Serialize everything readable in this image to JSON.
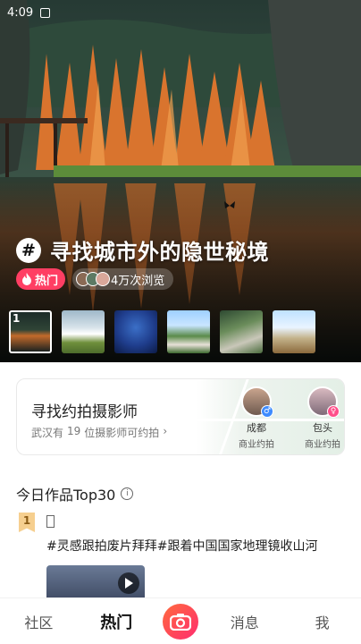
{
  "status_bar": {
    "time": "4:09"
  },
  "hero": {
    "title": "寻找城市外的隐世秘境",
    "hot_label": "热门",
    "views_label": "4万次浏览",
    "thumbnails": [
      {
        "index_label": "1",
        "active": true
      },
      {
        "index_label": "",
        "active": false
      },
      {
        "index_label": "",
        "active": false
      },
      {
        "index_label": "",
        "active": false
      },
      {
        "index_label": "",
        "active": false
      },
      {
        "index_label": "",
        "active": false
      }
    ]
  },
  "photographer_card": {
    "title": "寻找约拍摄影师",
    "subtitle_prefix": "武汉有",
    "subtitle_count": "19",
    "subtitle_suffix": "位摄影师可约拍",
    "people": [
      {
        "city": "成都",
        "tag": "商业约拍",
        "gender": "male",
        "gender_color": "#3d8bff"
      },
      {
        "city": "包头",
        "tag": "商业约拍",
        "gender": "female",
        "gender_color": "#ff4f8a"
      }
    ]
  },
  "top30": {
    "title": "今日作品Top30",
    "items": [
      {
        "rank": "1",
        "tags": "#灵感跟拍废片拜拜#跟着中国国家地理镜收山河"
      }
    ]
  },
  "tabbar": {
    "tabs": [
      "社区",
      "热门",
      "消息",
      "我"
    ],
    "active": "热门"
  },
  "colors": {
    "hot": "#ff3e63",
    "camera_button": "#ff2d6f",
    "rank_gold": "#f6cf8f"
  }
}
